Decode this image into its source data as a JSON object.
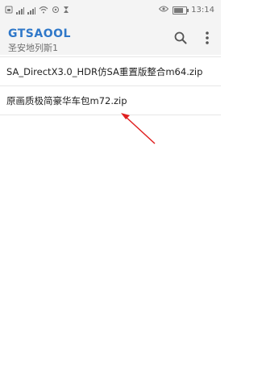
{
  "status_bar": {
    "time": "13:14",
    "network_label": "4G",
    "battery_level": 0.7
  },
  "app_bar": {
    "title": "GTSAOOL",
    "subtitle": "圣安地列斯1"
  },
  "files": [
    {
      "name": "SA_DirectX3.0_HDR仿SA重置版整合m64.zip"
    },
    {
      "name": "原画质极简豪华车包m72.zip"
    }
  ],
  "colors": {
    "title_accent": "#2f78c9",
    "annotation_arrow": "#e02020"
  }
}
